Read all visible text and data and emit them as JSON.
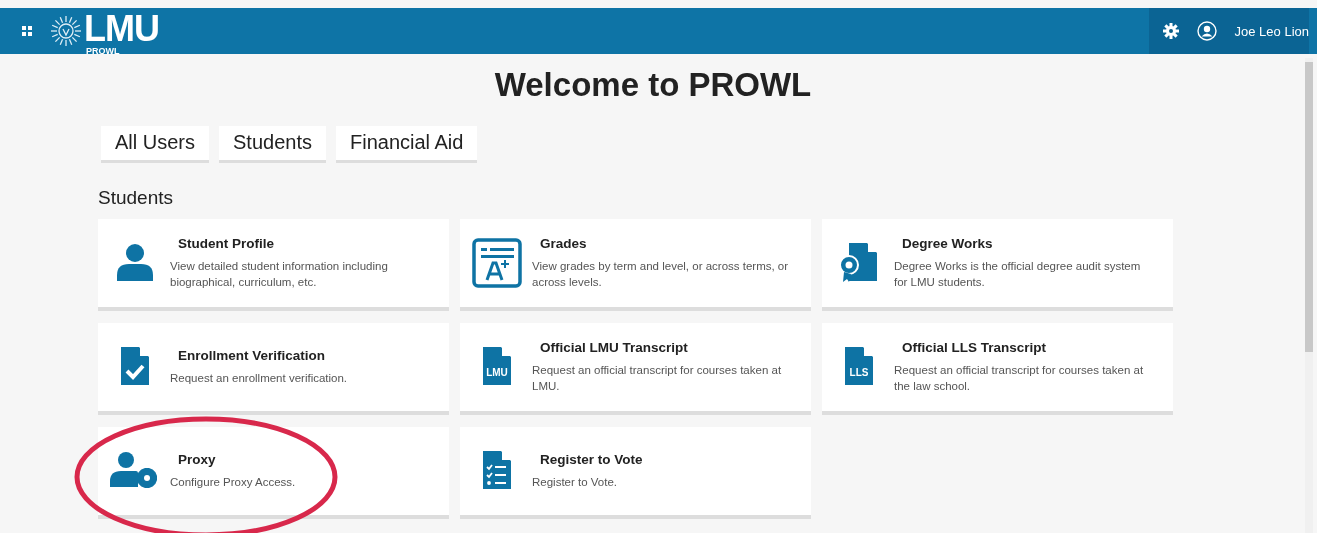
{
  "header": {
    "logo_text": "LMU",
    "logo_subtext": "PROWL",
    "user_name": "Joe Leo Lion"
  },
  "title": "Welcome to PROWL",
  "filters": [
    "All Users",
    "Students",
    "Financial Aid"
  ],
  "section": {
    "heading": "Students",
    "cards": [
      {
        "kind": "person",
        "title": "Student Profile",
        "description": "View detailed student information including biographical, curriculum, etc.",
        "circled": false
      },
      {
        "kind": "grades",
        "title": "Grades",
        "description": "View grades by term and level, or across terms, or across levels.",
        "circled": false
      },
      {
        "kind": "certificate",
        "title": "Degree Works",
        "description": "Degree Works is the official degree audit system for LMU students.",
        "circled": false
      },
      {
        "kind": "check",
        "title": "Enrollment Verification",
        "description": "Request an enrollment verification.",
        "circled": false
      },
      {
        "kind": "labeled",
        "badge": "LMU",
        "title": "Official LMU Transcript",
        "description": "Request an official transcript for courses taken at LMU.",
        "circled": false
      },
      {
        "kind": "labeled",
        "badge": "LLS",
        "title": "Official LLS Transcript",
        "description": "Request an official transcript for courses taken at the law school.",
        "circled": false
      },
      {
        "kind": "person-gear",
        "title": "Proxy",
        "description": "Configure Proxy Access.",
        "circled": true
      },
      {
        "kind": "checklist",
        "title": "Register to Vote",
        "description": "Register to Vote.",
        "circled": false
      }
    ]
  }
}
